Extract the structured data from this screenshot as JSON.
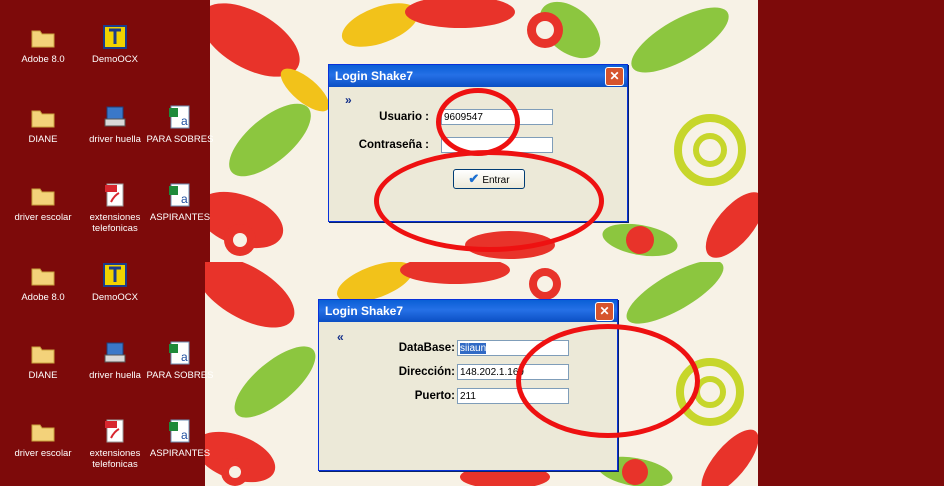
{
  "desktop_icons": [
    {
      "label": "Adobe 8.0",
      "icon": "folder-icon"
    },
    {
      "label": "DemoOCX",
      "icon": "demoocx-app-icon"
    },
    {
      "label": "DIANE",
      "icon": "folder-icon"
    },
    {
      "label": "driver huella",
      "icon": "installer-computer-icon"
    },
    {
      "label": "PARA SOBRES",
      "icon": "excel-document-icon"
    },
    {
      "label": "driver escolar",
      "icon": "folder-icon"
    },
    {
      "label": "extensiones telefonicas",
      "icon": "pdf-document-icon"
    },
    {
      "label": "ASPIRANTES",
      "icon": "excel-document-icon"
    }
  ],
  "dialog_top": {
    "title": "Login Shake7",
    "close_glyph": "✕",
    "toggle": "»",
    "usuario_label": "Usuario :",
    "usuario_value": "9609547",
    "contrasena_label": "Contraseña :",
    "contrasena_value": "",
    "enter_button": "Entrar"
  },
  "dialog_bottom": {
    "title": "Login Shake7",
    "close_glyph": "✕",
    "toggle": "«",
    "database_label": "DataBase:",
    "database_value": "siiaun",
    "direccion_label": "Dirección:",
    "direccion_value": "148.202.1.169",
    "puerto_label": "Puerto:",
    "puerto_value": "211"
  },
  "colors": {
    "desktop": "#7d0a0a",
    "titlebar": "#0a5fd6",
    "dialog_body": "#ece9d8",
    "annotation_circle": "#ee1111"
  }
}
